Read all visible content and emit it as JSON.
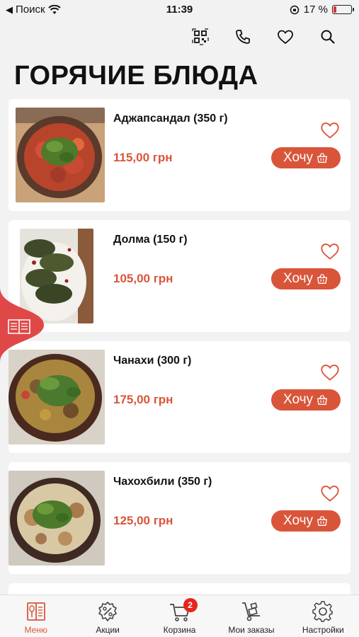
{
  "status_bar": {
    "back_label": "Поиск",
    "time": "11:39",
    "battery_percent": "17 %",
    "battery_level": 0.17
  },
  "page": {
    "title": "ГОРЯЧИЕ БЛЮДА"
  },
  "items": [
    {
      "name": "Аджапсандал (350 г)",
      "price": "115,00 грн",
      "button": "Хочу"
    },
    {
      "name": "Долма (150 г)",
      "price": "105,00 грн",
      "button": "Хочу"
    },
    {
      "name": "Чанахи (300 г)",
      "price": "175,00 грн",
      "button": "Хочу"
    },
    {
      "name": "Чахохбили (350 г)",
      "price": "125,00 грн",
      "button": "Хочу"
    }
  ],
  "tabbar": {
    "tabs": [
      {
        "label": "Меню",
        "active": true
      },
      {
        "label": "Акции"
      },
      {
        "label": "Корзина",
        "badge": "2"
      },
      {
        "label": "Мои заказы"
      },
      {
        "label": "Настройки"
      }
    ]
  },
  "colors": {
    "accent": "#d9553a",
    "badge": "#e8251c",
    "background": "#f2f2f2"
  }
}
